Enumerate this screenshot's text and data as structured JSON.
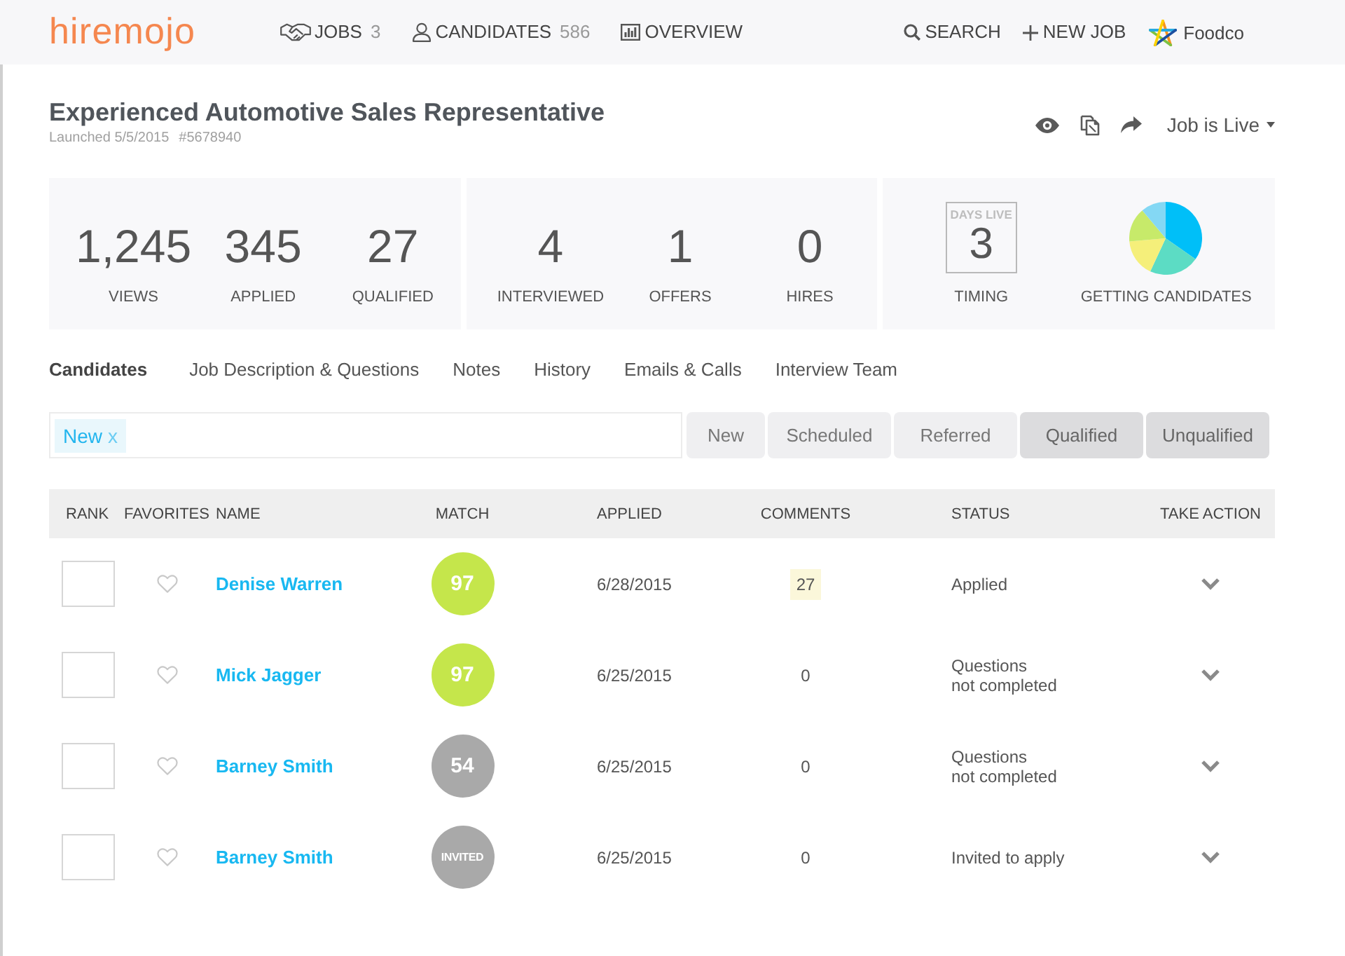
{
  "nav": {
    "logo": "hiremojo",
    "items": [
      {
        "label": "JOBS",
        "count": "3"
      },
      {
        "label": "CANDIDATES",
        "count": "586"
      },
      {
        "label": "OVERVIEW"
      }
    ],
    "actions": [
      {
        "label": "SEARCH"
      },
      {
        "label": "NEW JOB"
      }
    ],
    "account": {
      "name": "Foodco"
    }
  },
  "job": {
    "title": "Experienced Automotive Sales Representative",
    "launched": "Launched 5/5/2015",
    "number": "#5678940",
    "status": "Job is Live"
  },
  "stats": {
    "groups": [
      [
        {
          "value": "1,245",
          "label": "VIEWS"
        },
        {
          "value": "345",
          "label": "APPLIED"
        },
        {
          "value": "27",
          "label": "QUALIFIED"
        }
      ],
      [
        {
          "value": "4",
          "label": "INTERVIEWED"
        },
        {
          "value": "1",
          "label": "OFFERS"
        },
        {
          "value": "0",
          "label": "HIRES"
        }
      ]
    ],
    "timing": {
      "caption": "DAYS LIVE",
      "value": "3",
      "label": "TIMING"
    },
    "pipeline": {
      "label": "GETTING CANDIDATES"
    }
  },
  "tabs": [
    {
      "label": "Candidates",
      "selected": true
    },
    {
      "label": "Job Description & Questions",
      "selected": false
    },
    {
      "label": "Notes",
      "selected": false
    },
    {
      "label": "History",
      "selected": false
    },
    {
      "label": "Emails & Calls",
      "selected": false
    },
    {
      "label": "Interview Team",
      "selected": false
    }
  ],
  "filter": {
    "tags": [
      {
        "label": "New",
        "remove": "x"
      }
    ],
    "buttons": [
      {
        "label": "New",
        "selected": false
      },
      {
        "label": "Scheduled",
        "selected": false
      },
      {
        "label": "Referred",
        "selected": false
      },
      {
        "label": "Qualified",
        "selected": true
      },
      {
        "label": "Unqualified",
        "selected": true
      }
    ]
  },
  "table": {
    "columns": [
      "RANK",
      "FAVORITES",
      "NAME",
      "MATCH",
      "APPLIED",
      "COMMENTS",
      "STATUS",
      "TAKE ACTION"
    ],
    "rows": [
      {
        "favorite": false,
        "name": "Denise Warren",
        "match": {
          "kind": "score",
          "text": "97",
          "color": "#c5e64b"
        },
        "applied": "6/28/2015",
        "comments": {
          "text": "27",
          "highlighted": true
        },
        "status": "Applied"
      },
      {
        "favorite": false,
        "name": "Mick Jagger",
        "match": {
          "kind": "score",
          "text": "97",
          "color": "#c5e64b"
        },
        "applied": "6/25/2015",
        "comments": {
          "text": "0",
          "highlighted": false
        },
        "status": "Questions\nnot completed"
      },
      {
        "favorite": false,
        "name": "Barney Smith",
        "match": {
          "kind": "score",
          "text": "54",
          "color": "#a9a9a9"
        },
        "applied": "6/25/2015",
        "comments": {
          "text": "0",
          "highlighted": false
        },
        "status": "Questions\nnot completed"
      },
      {
        "favorite": false,
        "name": "Barney Smith",
        "match": {
          "kind": "label",
          "text": "INVITED",
          "color": "#a9a9a9"
        },
        "applied": "6/25/2015",
        "comments": {
          "text": "0",
          "highlighted": false
        },
        "status": "Invited to apply"
      }
    ]
  }
}
